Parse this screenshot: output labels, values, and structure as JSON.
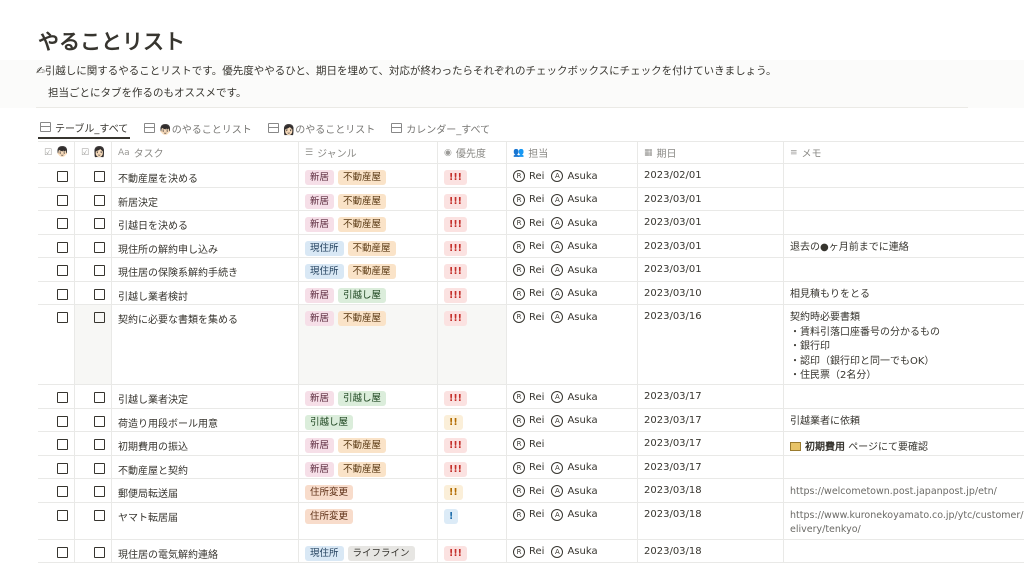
{
  "page": {
    "title": "やることリスト",
    "description_line1": "✍引越しに関するやることリストです。優先度ややるひと、期日を埋めて、対応が終わったらそれぞれのチェックボックスにチェックを付けていきましょう。",
    "description_line2": "担当ごとにタブを作るのもオススメです。"
  },
  "tabs": [
    {
      "label": "テーブル_すべて",
      "active": true,
      "icon": "table-icon"
    },
    {
      "label": "👦🏻のやることリスト",
      "active": false,
      "icon": "table-icon"
    },
    {
      "label": "👩🏻のやることリスト",
      "active": false,
      "icon": "table-icon"
    },
    {
      "label": "カレンダー_すべて",
      "active": false,
      "icon": "calendar-icon"
    }
  ],
  "columns": {
    "check1": "👦🏻",
    "check2": "👩🏻",
    "task": "タスク",
    "genre": "ジャンル",
    "priority": "優先度",
    "assignee": "担当",
    "due": "期日",
    "memo": "メモ"
  },
  "tag_colors": {
    "新居": {
      "bg": "#f6dfe8",
      "fg": "#5b2a3d"
    },
    "不動産屋": {
      "bg": "#fae3c8",
      "fg": "#5a3a14"
    },
    "現住所": {
      "bg": "#d9e8f5",
      "fg": "#1f3d5a"
    },
    "引越し屋": {
      "bg": "#dbeddb",
      "fg": "#1e4620"
    },
    "住所変更": {
      "bg": "#f8dccb",
      "fg": "#5c2e14"
    },
    "ライフライン": {
      "bg": "#e7e6e3",
      "fg": "#37352f"
    }
  },
  "priority_colors": {
    "!!!": {
      "bg": "#fbe2e1",
      "fg": "#c4302b"
    },
    "!!": {
      "bg": "#fbefd9",
      "fg": "#b26b00"
    },
    "!": {
      "bg": "#dcebf7",
      "fg": "#1f6eab"
    }
  },
  "rows": [
    {
      "task": "不動産屋を決める",
      "genres": [
        "新居",
        "不動産屋"
      ],
      "priority": "!!!",
      "assignees": [
        "Rei",
        "Asuka"
      ],
      "due": "2023/02/01",
      "memo": "",
      "memo_type": "text"
    },
    {
      "task": "新居決定",
      "genres": [
        "新居",
        "不動産屋"
      ],
      "priority": "!!!",
      "assignees": [
        "Rei",
        "Asuka"
      ],
      "due": "2023/03/01",
      "memo": "",
      "memo_type": "text"
    },
    {
      "task": "引越日を決める",
      "genres": [
        "新居",
        "不動産屋"
      ],
      "priority": "!!!",
      "assignees": [
        "Rei",
        "Asuka"
      ],
      "due": "2023/03/01",
      "memo": "",
      "memo_type": "text"
    },
    {
      "task": "現住所の解約申し込み",
      "genres": [
        "現住所",
        "不動産屋"
      ],
      "priority": "!!!",
      "assignees": [
        "Rei",
        "Asuka"
      ],
      "due": "2023/03/01",
      "memo": "退去の●ヶ月前までに連絡",
      "memo_type": "text"
    },
    {
      "task": "現住居の保険系解約手続き",
      "genres": [
        "現住所",
        "不動産屋"
      ],
      "priority": "!!!",
      "assignees": [
        "Rei",
        "Asuka"
      ],
      "due": "2023/03/01",
      "memo": "",
      "memo_type": "text"
    },
    {
      "task": "引越し業者検討",
      "genres": [
        "新居",
        "引越し屋"
      ],
      "priority": "!!!",
      "assignees": [
        "Rei",
        "Asuka"
      ],
      "due": "2023/03/10",
      "memo": "相見積もりをとる",
      "memo_type": "text"
    },
    {
      "task": "契約に必要な書類を集める",
      "genres": [
        "新居",
        "不動産屋"
      ],
      "priority": "!!!",
      "assignees": [
        "Rei",
        "Asuka"
      ],
      "due": "2023/03/16",
      "memo": "契約時必要書類\n・賃料引落口座番号の分かるもの\n・銀行印\n・認印（銀行印と同一でもOK）\n・住民票（2名分）",
      "memo_type": "text",
      "tall": true
    },
    {
      "task": "引越し業者決定",
      "genres": [
        "新居",
        "引越し屋"
      ],
      "priority": "!!!",
      "assignees": [
        "Rei",
        "Asuka"
      ],
      "due": "2023/03/17",
      "memo": "",
      "memo_type": "text"
    },
    {
      "task": "荷造り用段ボール用意",
      "genres": [
        "引越し屋"
      ],
      "priority": "!!",
      "assignees": [
        "Rei",
        "Asuka"
      ],
      "due": "2023/03/17",
      "memo": "引越業者に依頼",
      "memo_type": "text"
    },
    {
      "task": "初期費用の振込",
      "genres": [
        "新居",
        "不動産屋"
      ],
      "priority": "!!!",
      "assignees": [
        "Rei"
      ],
      "due": "2023/03/17",
      "memo_page": "初期費用",
      "memo": "ページにて要確認",
      "memo_type": "page"
    },
    {
      "task": "不動産屋と契約",
      "genres": [
        "新居",
        "不動産屋"
      ],
      "priority": "!!!",
      "assignees": [
        "Rei",
        "Asuka"
      ],
      "due": "2023/03/17",
      "memo": "",
      "memo_type": "text"
    },
    {
      "task": "郵便局転送届",
      "genres": [
        "住所変更"
      ],
      "priority": "!!",
      "assignees": [
        "Rei",
        "Asuka"
      ],
      "due": "2023/03/18",
      "memo": "https://welcometown.post.japanpost.jp/etn/",
      "memo_type": "link"
    },
    {
      "task": "ヤマト転居届",
      "genres": [
        "住所変更"
      ],
      "priority": "!",
      "assignees": [
        "Rei",
        "Asuka"
      ],
      "due": "2023/03/18",
      "memo": "https://www.kuronekoyamato.co.jp/ytc/customer/m\nelivery/tenkyo/",
      "memo_type": "link",
      "mid": true
    },
    {
      "task": "現住居の電気解約連絡",
      "genres": [
        "現住所",
        "ライフライン"
      ],
      "priority": "!!!",
      "assignees": [
        "Rei",
        "Asuka"
      ],
      "due": "2023/03/18",
      "memo": "",
      "memo_type": "text"
    }
  ]
}
